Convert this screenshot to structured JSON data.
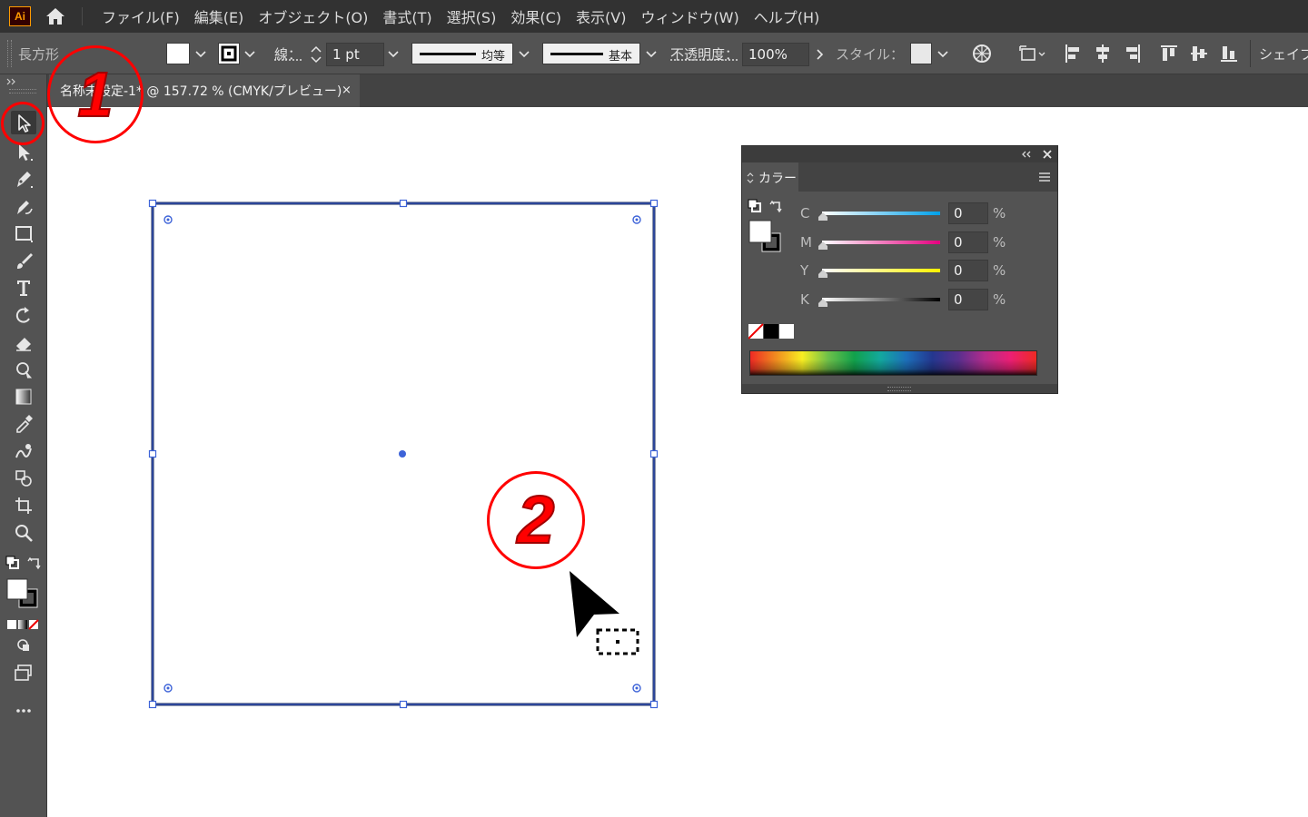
{
  "app": {
    "logo_text": "Ai",
    "brand_color": "#ff9a00"
  },
  "menu": [
    "ファイル(F)",
    "編集(E)",
    "オブジェクト(O)",
    "書式(T)",
    "選択(S)",
    "効果(C)",
    "表示(V)",
    "ウィンドウ(W)",
    "ヘルプ(H)"
  ],
  "control_bar": {
    "object_label": "長方形",
    "stroke_label": "線：",
    "stroke_weight": "1 pt",
    "stroke_profile_label": "均等",
    "brush_label": "基本",
    "opacity_label": "不透明度：",
    "opacity_value": "100%",
    "style_label": "スタイル：",
    "shape_label": "シェイプ"
  },
  "document_tab": {
    "title": "名称未設定-1* @ 157.72 % (CMYK/プレビュー)",
    "close": "×"
  },
  "color_panel": {
    "tab_label": "カラー",
    "channels": [
      {
        "letter": "C",
        "value": "0",
        "unit": "%",
        "gradient_end": "#00a0e9"
      },
      {
        "letter": "M",
        "value": "0",
        "unit": "%",
        "gradient_end": "#e4007f"
      },
      {
        "letter": "Y",
        "value": "0",
        "unit": "%",
        "gradient_end": "#fff100"
      },
      {
        "letter": "K",
        "value": "0",
        "unit": "%",
        "gradient_end": "#000000"
      }
    ]
  },
  "annotations": {
    "marker_1": "1",
    "marker_2": "2",
    "marker_color": "#ff0000"
  },
  "selection": {
    "color": "#3d63d8"
  }
}
